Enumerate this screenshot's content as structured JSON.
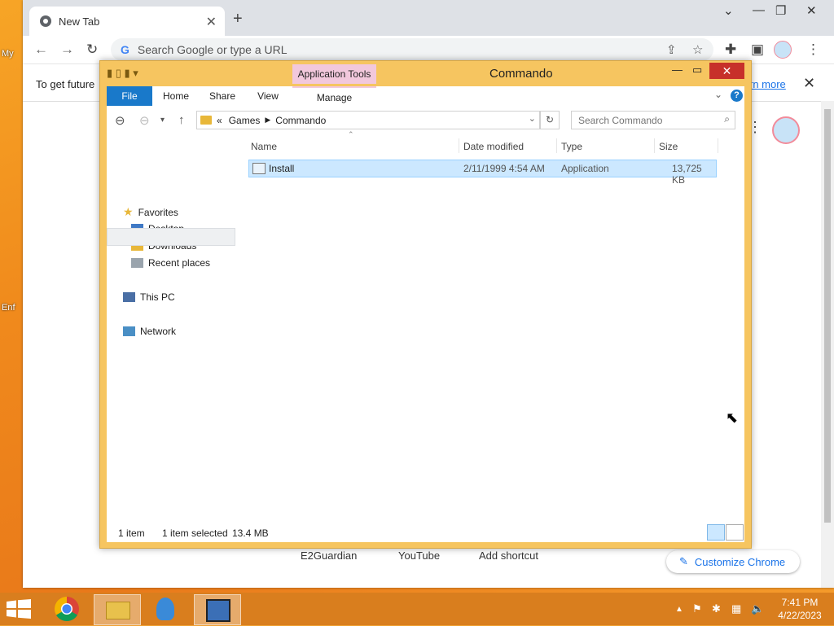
{
  "desktop": {
    "icon_labels": [
      "My",
      "Enf"
    ]
  },
  "chrome": {
    "tab_title": "New Tab",
    "tab_close": "✕",
    "new_tab": "+",
    "win_controls": [
      "⌄",
      "—",
      "❐",
      "✕"
    ],
    "omnibox_placeholder": "Search Google or type a URL",
    "google_letter": "G",
    "infobar_text": "To get future",
    "infobar_link": "rn more",
    "infobar_close": "✕",
    "shortcuts": [
      "E2Guardian",
      "YouTube",
      "Add shortcut"
    ],
    "customize_label": "Customize Chrome"
  },
  "explorer": {
    "title": "Commando",
    "context_tab": "Application Tools",
    "ribbon_tabs": [
      "File",
      "Home",
      "Share",
      "View",
      "Manage"
    ],
    "help": "?",
    "breadcrumb": [
      "«",
      "Games",
      "Commando"
    ],
    "search_placeholder": "Search Commando",
    "nav": {
      "favorites": "Favorites",
      "desktop": "Desktop",
      "downloads": "Downloads",
      "recent": "Recent places",
      "this_pc": "This PC",
      "network": "Network"
    },
    "columns": [
      "Name",
      "Date modified",
      "Type",
      "Size"
    ],
    "files": [
      {
        "name": "Install",
        "date": "2/11/1999 4:54 AM",
        "type": "Application",
        "size": "13,725 KB",
        "selected": true
      }
    ],
    "status": {
      "count": "1 item",
      "selected": "1 item selected",
      "size": "13.4 MB"
    }
  },
  "taskbar": {
    "time": "7:41 PM",
    "date": "4/22/2023"
  }
}
